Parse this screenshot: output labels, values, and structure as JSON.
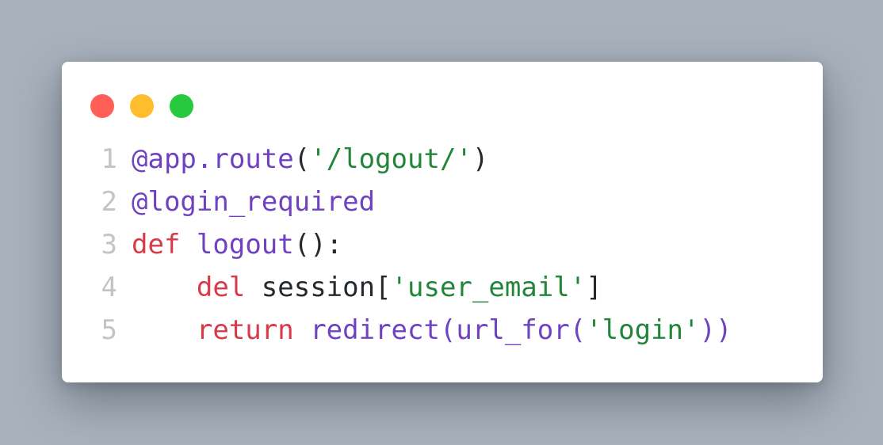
{
  "theme": {
    "background": "#a9b2bc",
    "card": "#ffffff",
    "dot_red": "#ff5f56",
    "dot_yellow": "#ffbd2e",
    "dot_green": "#27c93f",
    "line_number": "#c4c4c4",
    "keyword": "#d73a49",
    "decorator_function": "#6f42c1",
    "string": "#22863a",
    "plain": "#24292e"
  },
  "window_controls": [
    "close-dot",
    "minimize-dot",
    "maximize-dot"
  ],
  "code": {
    "lines": [
      {
        "number": "1",
        "tokens": [
          {
            "text": "@app.route",
            "type": "deco"
          },
          {
            "text": "(",
            "type": "plain"
          },
          {
            "text": "'/logout/'",
            "type": "str"
          },
          {
            "text": ")",
            "type": "plain"
          }
        ]
      },
      {
        "number": "2",
        "tokens": [
          {
            "text": "@login_required",
            "type": "deco"
          }
        ]
      },
      {
        "number": "3",
        "tokens": [
          {
            "text": "def",
            "type": "kw"
          },
          {
            "text": " ",
            "type": "plain"
          },
          {
            "text": "logout",
            "type": "func"
          },
          {
            "text": "():",
            "type": "plain"
          }
        ]
      },
      {
        "number": "4",
        "tokens": [
          {
            "text": "    ",
            "type": "plain"
          },
          {
            "text": "del",
            "type": "kw"
          },
          {
            "text": " session[",
            "type": "plain"
          },
          {
            "text": "'user_email'",
            "type": "str"
          },
          {
            "text": "]",
            "type": "plain"
          }
        ]
      },
      {
        "number": "5",
        "tokens": [
          {
            "text": "    ",
            "type": "plain"
          },
          {
            "text": "return",
            "type": "kw"
          },
          {
            "text": " ",
            "type": "plain"
          },
          {
            "text": "redirect(url_for(",
            "type": "func"
          },
          {
            "text": "'login'",
            "type": "str"
          },
          {
            "text": "))",
            "type": "func"
          }
        ]
      }
    ]
  }
}
